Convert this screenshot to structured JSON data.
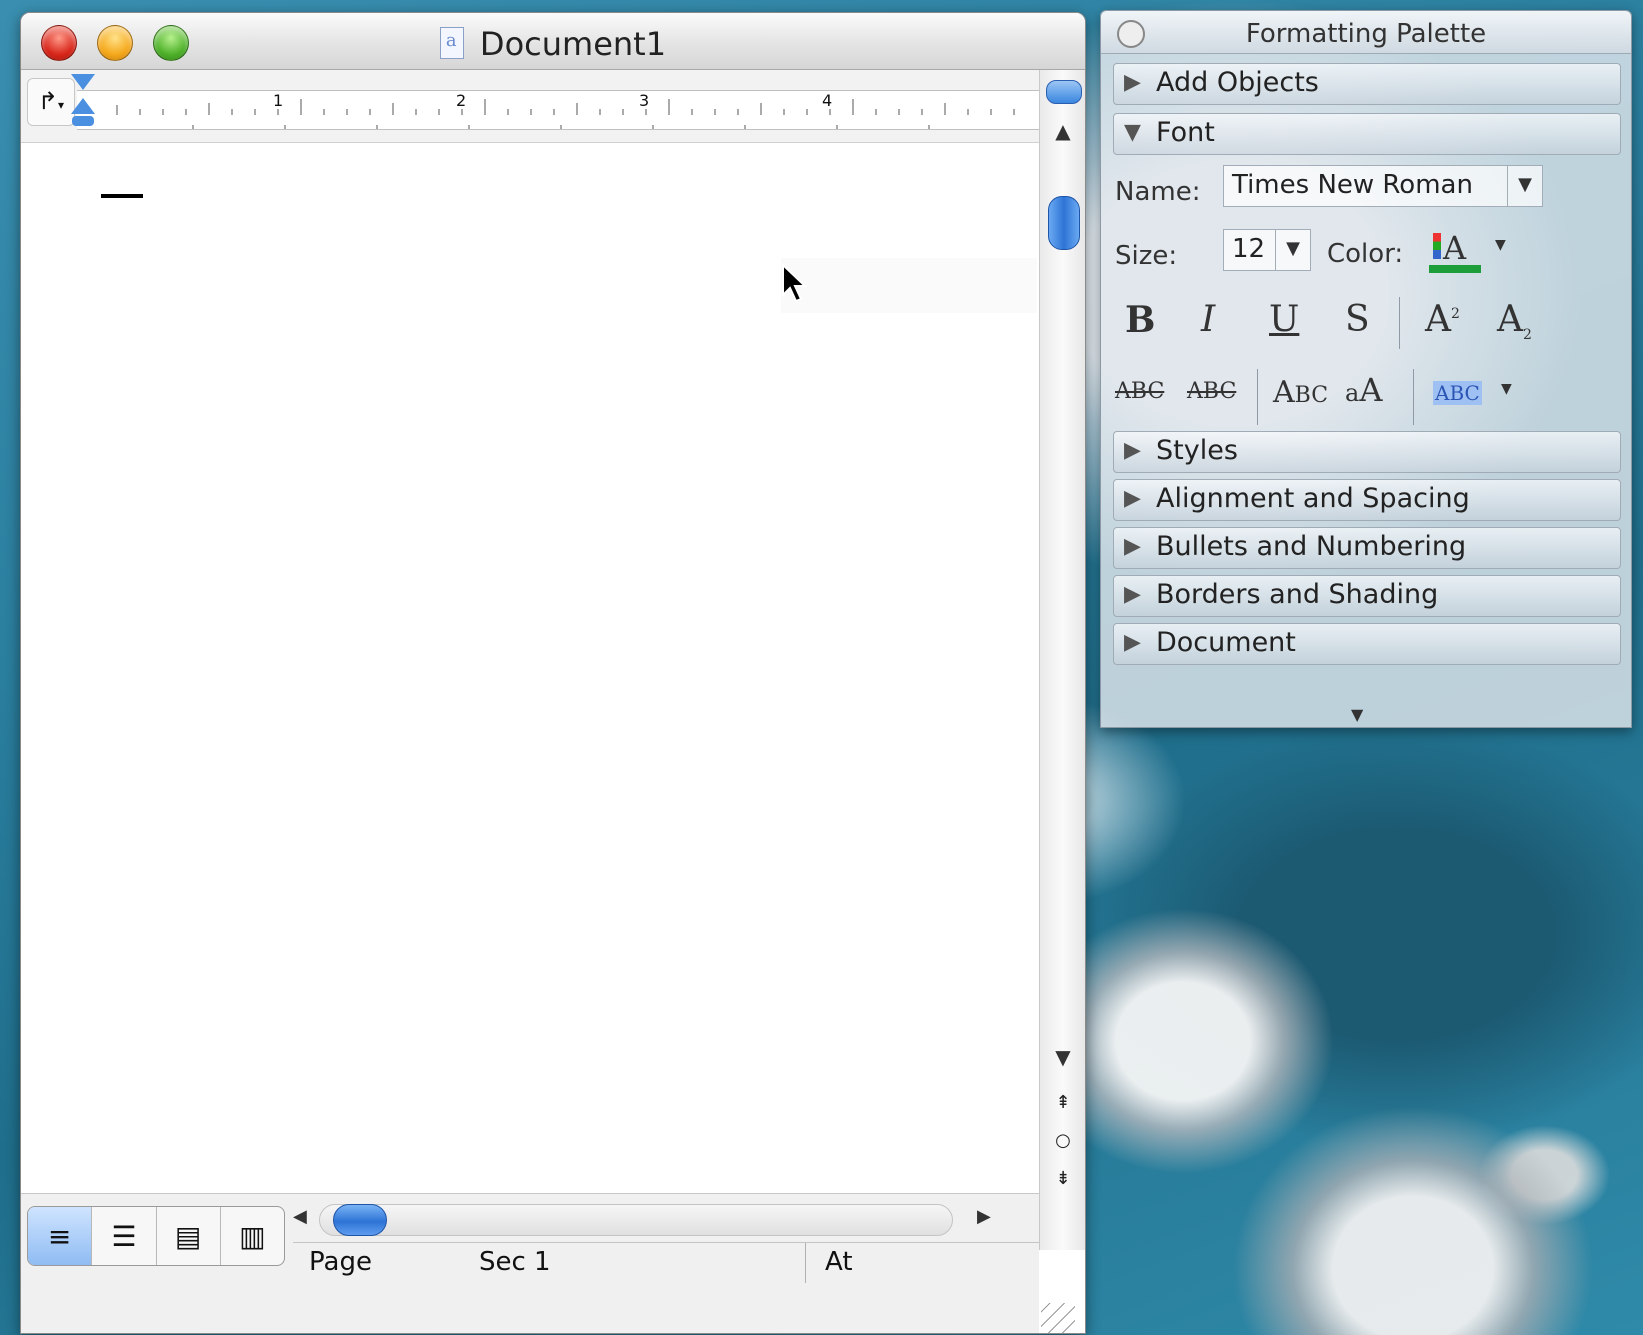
{
  "document": {
    "title": "Document1",
    "ruler_numbers": [
      "1",
      "2",
      "3",
      "4"
    ],
    "status": {
      "page": "Page",
      "section": "Sec 1",
      "at": "At"
    },
    "view_buttons": [
      "normal-view",
      "outline-view",
      "page-layout-view",
      "notebook-view"
    ]
  },
  "palette": {
    "title": "Formatting Palette",
    "sections_top": [
      {
        "label": "Add Objects",
        "expanded": false
      },
      {
        "label": "Font",
        "expanded": true
      }
    ],
    "font": {
      "name_label": "Name:",
      "name_value": "Times New Roman",
      "size_label": "Size:",
      "size_value": "12",
      "color_label": "Color:",
      "color_swatch": "#1e9e3a"
    },
    "sections_bottom": [
      {
        "label": "Styles",
        "expanded": false
      },
      {
        "label": "Alignment and Spacing",
        "expanded": false
      },
      {
        "label": "Bullets and Numbering",
        "expanded": false
      },
      {
        "label": "Borders and Shading",
        "expanded": false
      },
      {
        "label": "Document",
        "expanded": false
      }
    ]
  }
}
